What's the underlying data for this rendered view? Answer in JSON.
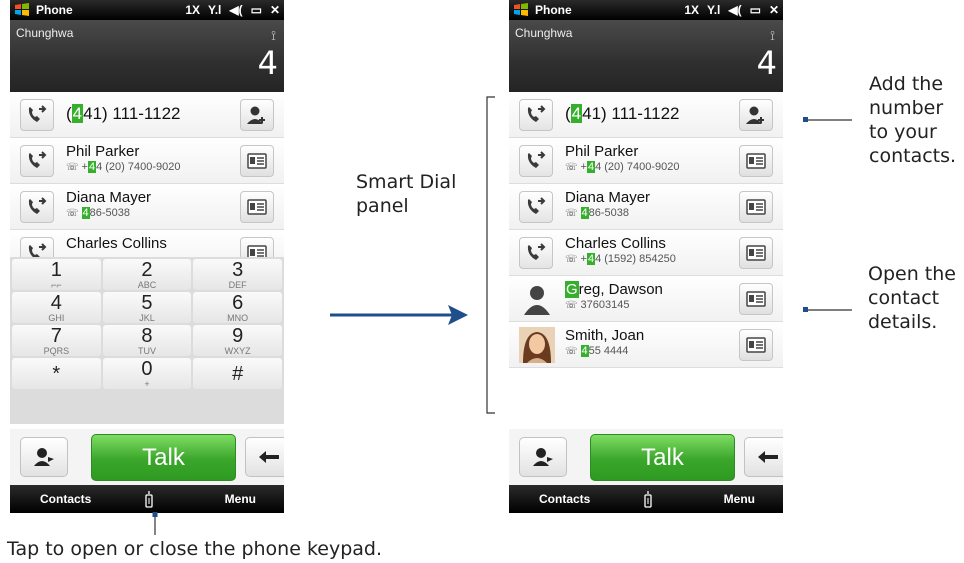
{
  "status": {
    "title": "Phone",
    "network": "1X",
    "signal": "Y.l",
    "speaker": "◀(",
    "battery": "▭",
    "close": "✕"
  },
  "carrier": {
    "name": "Chunghwa",
    "antenna": "⟟",
    "count": "4"
  },
  "left": {
    "rows": [
      {
        "type": "number",
        "prefix": "",
        "hl": "4",
        "rest": "41) 111-1122",
        "open": "("
      },
      {
        "type": "contact",
        "name": "Phil Parker",
        "sub_pre": "+",
        "sub_hl": "4",
        "sub_rest": "4 (20) 7400-9020"
      },
      {
        "type": "contact",
        "name": "Diana Mayer",
        "sub_pre": "",
        "sub_hl": "4",
        "sub_rest": "86-5038"
      },
      {
        "type": "contact",
        "name": "Charles Collins",
        "sub_pre": "",
        "sub_hl": "",
        "sub_rest": ""
      }
    ],
    "keys": [
      {
        "d": "1",
        "l": "⌐⌐"
      },
      {
        "d": "2",
        "l": "ABC"
      },
      {
        "d": "3",
        "l": "DEF"
      },
      {
        "d": "4",
        "l": "GHI"
      },
      {
        "d": "5",
        "l": "JKL"
      },
      {
        "d": "6",
        "l": "MNO"
      },
      {
        "d": "7",
        "l": "PQRS"
      },
      {
        "d": "8",
        "l": "TUV"
      },
      {
        "d": "9",
        "l": "WXYZ"
      },
      {
        "d": "*",
        "l": ""
      },
      {
        "d": "0",
        "l": "+"
      },
      {
        "d": "#",
        "l": ""
      }
    ]
  },
  "right": {
    "rows": [
      {
        "type": "number",
        "hl": "4",
        "rest": "41) 111-1122",
        "open": "("
      },
      {
        "type": "contact",
        "name": "Phil Parker",
        "sub_pre": "+",
        "sub_hl": "4",
        "sub_rest": "4 (20) 7400-9020"
      },
      {
        "type": "contact",
        "name": "Diana Mayer",
        "sub_pre": "",
        "sub_hl": "4",
        "sub_rest": "86-5038"
      },
      {
        "type": "contact",
        "name": "Charles Collins",
        "sub_pre": "+",
        "sub_hl": "4",
        "sub_rest": "4 (1592) 854250"
      },
      {
        "type": "contact2",
        "name_hl": "G",
        "name_rest": "reg, Dawson",
        "sub_pre": "",
        "sub_hl": "",
        "sub_rest": "37603145"
      },
      {
        "type": "contact3",
        "name": "Smith, Joan",
        "sub_pre": "",
        "sub_hl": "4",
        "sub_rest": "55 4444"
      }
    ]
  },
  "actions": {
    "talk": "Talk",
    "contacts_soft": "Contacts",
    "menu_soft": "Menu"
  },
  "annotations": {
    "smart_dial": "Smart Dial\npanel",
    "add_number": "Add the\nnumber\nto your\ncontacts.",
    "open_details": "Open the\ncontact\ndetails.",
    "keypad_tip": "Tap to open or close the phone keypad."
  },
  "colors": {
    "accent_green": "#36b02c",
    "arrow_blue": "#1f4e8c"
  }
}
